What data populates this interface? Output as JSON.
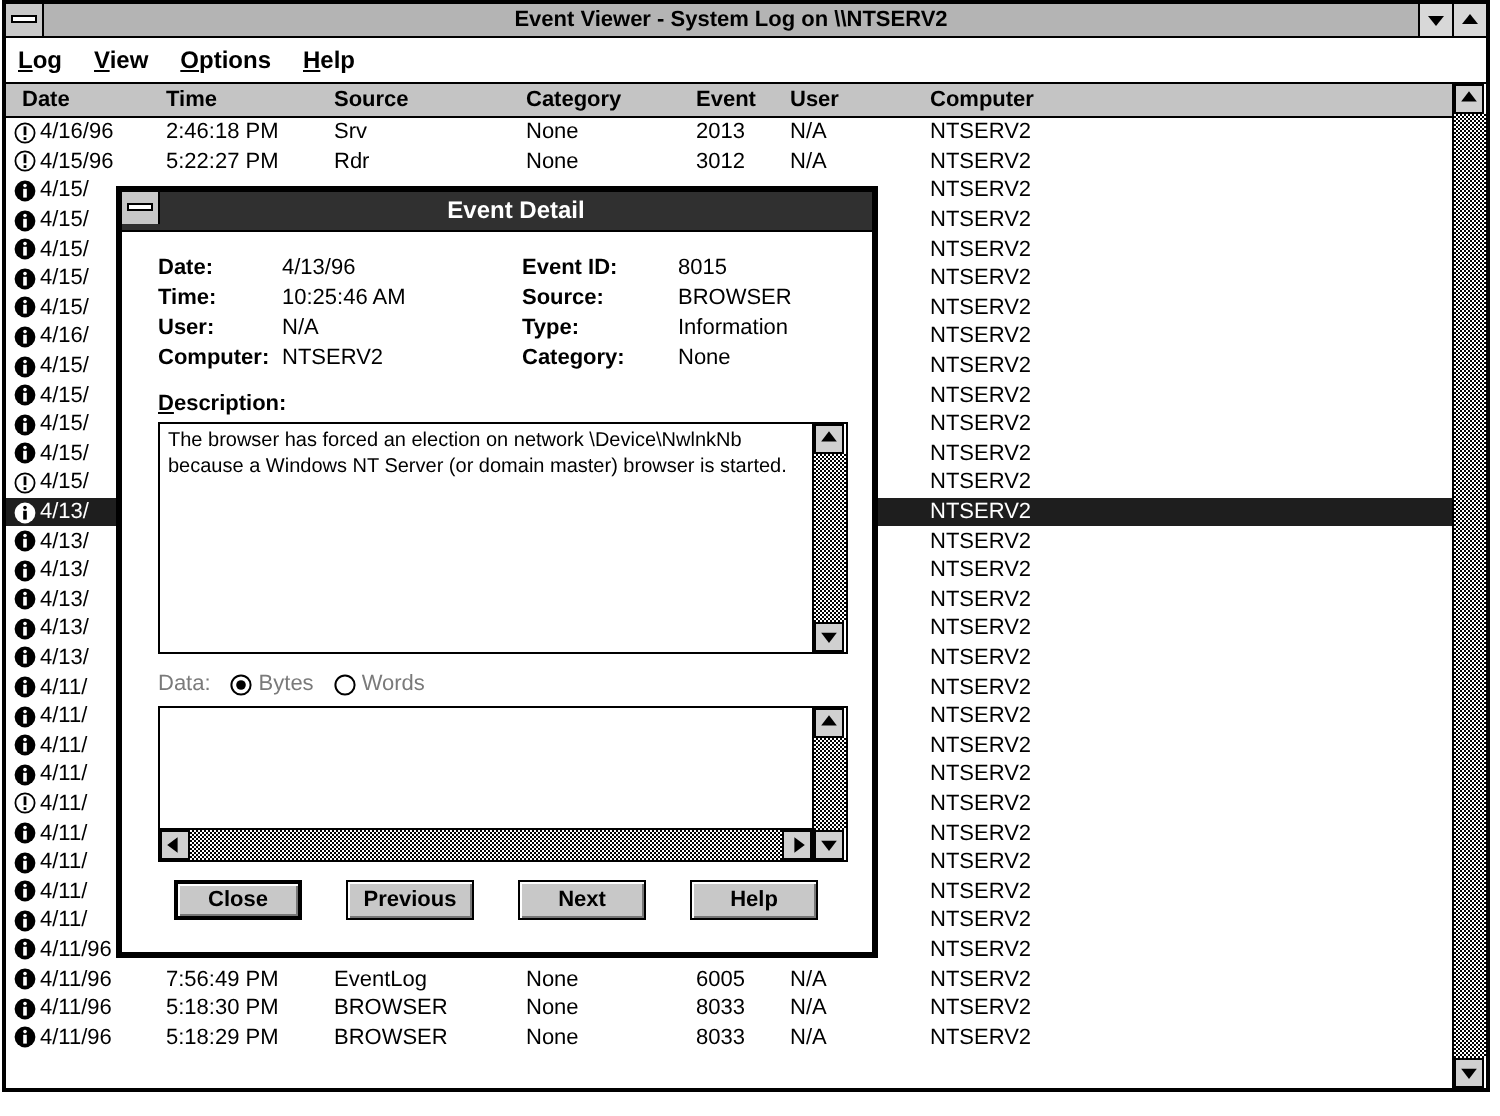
{
  "window": {
    "title": "Event Viewer - System Log on \\\\NTSERV2"
  },
  "menu": [
    {
      "label": "Log"
    },
    {
      "label": "View"
    },
    {
      "label": "Options"
    },
    {
      "label": "Help"
    }
  ],
  "columns": [
    "Date",
    "Time",
    "Source",
    "Category",
    "Event",
    "User",
    "Computer"
  ],
  "rows": [
    {
      "kind": "warning",
      "selected": false,
      "date": "4/16/96",
      "time": "2:46:18 PM",
      "source": "Srv",
      "category": "None",
      "event": "2013",
      "user": "N/A",
      "computer": "NTSERV2"
    },
    {
      "kind": "warning",
      "selected": false,
      "date": "4/15/96",
      "time": "5:22:27 PM",
      "source": "Rdr",
      "category": "None",
      "event": "3012",
      "user": "N/A",
      "computer": "NTSERV2"
    },
    {
      "kind": "info",
      "selected": false,
      "date": "4/15/",
      "computer": "NTSERV2"
    },
    {
      "kind": "info",
      "selected": false,
      "date": "4/15/",
      "computer": "NTSERV2"
    },
    {
      "kind": "info",
      "selected": false,
      "date": "4/15/",
      "computer": "NTSERV2"
    },
    {
      "kind": "info",
      "selected": false,
      "date": "4/15/",
      "computer": "NTSERV2"
    },
    {
      "kind": "info",
      "selected": false,
      "date": "4/15/",
      "computer": "NTSERV2"
    },
    {
      "kind": "info",
      "selected": false,
      "date": "4/16/",
      "computer": "NTSERV2"
    },
    {
      "kind": "info",
      "selected": false,
      "date": "4/15/",
      "computer": "NTSERV2"
    },
    {
      "kind": "info",
      "selected": false,
      "date": "4/15/",
      "computer": "NTSERV2"
    },
    {
      "kind": "info",
      "selected": false,
      "date": "4/15/",
      "computer": "NTSERV2"
    },
    {
      "kind": "info",
      "selected": false,
      "date": "4/15/",
      "computer": "NTSERV2"
    },
    {
      "kind": "warning",
      "selected": false,
      "date": "4/15/",
      "computer": "NTSERV2"
    },
    {
      "kind": "info",
      "selected": true,
      "date": "4/13/",
      "computer": "NTSERV2"
    },
    {
      "kind": "info",
      "selected": false,
      "date": "4/13/",
      "computer": "NTSERV2"
    },
    {
      "kind": "info",
      "selected": false,
      "date": "4/13/",
      "computer": "NTSERV2"
    },
    {
      "kind": "info",
      "selected": false,
      "date": "4/13/",
      "computer": "NTSERV2"
    },
    {
      "kind": "info",
      "selected": false,
      "date": "4/13/",
      "computer": "NTSERV2"
    },
    {
      "kind": "info",
      "selected": false,
      "date": "4/13/",
      "computer": "NTSERV2"
    },
    {
      "kind": "info",
      "selected": false,
      "date": "4/11/",
      "computer": "NTSERV2"
    },
    {
      "kind": "info",
      "selected": false,
      "date": "4/11/",
      "computer": "NTSERV2"
    },
    {
      "kind": "info",
      "selected": false,
      "date": "4/11/",
      "computer": "NTSERV2"
    },
    {
      "kind": "info",
      "selected": false,
      "date": "4/11/",
      "computer": "NTSERV2"
    },
    {
      "kind": "warning",
      "selected": false,
      "date": "4/11/",
      "computer": "NTSERV2"
    },
    {
      "kind": "info",
      "selected": false,
      "date": "4/11/",
      "computer": "NTSERV2"
    },
    {
      "kind": "info",
      "selected": false,
      "date": "4/11/",
      "computer": "NTSERV2"
    },
    {
      "kind": "info",
      "selected": false,
      "date": "4/11/",
      "computer": "NTSERV2"
    },
    {
      "kind": "info",
      "selected": false,
      "date": "4/11/",
      "computer": "NTSERV2"
    },
    {
      "kind": "info",
      "selected": false,
      "date": "4/11/96",
      "computer": "NTSERV2"
    },
    {
      "kind": "info",
      "selected": false,
      "date": "4/11/96",
      "time": "7:56:49 PM",
      "source": "EventLog",
      "category": "None",
      "event": "6005",
      "user": "N/A",
      "computer": "NTSERV2"
    },
    {
      "kind": "info",
      "selected": false,
      "date": "4/11/96",
      "time": "5:18:30 PM",
      "source": "BROWSER",
      "category": "None",
      "event": "8033",
      "user": "N/A",
      "computer": "NTSERV2"
    },
    {
      "kind": "info",
      "selected": false,
      "date": "4/11/96",
      "time": "5:18:29 PM",
      "source": "BROWSER",
      "category": "None",
      "event": "8033",
      "user": "N/A",
      "computer": "NTSERV2"
    }
  ],
  "dialog": {
    "title": "Event Detail",
    "left_fields": [
      {
        "label": "Date:",
        "value": "4/13/96"
      },
      {
        "label": "Time:",
        "value": "10:25:46 AM"
      },
      {
        "label": "User:",
        "value": "N/A"
      },
      {
        "label": "Computer:",
        "value": "NTSERV2"
      }
    ],
    "right_fields": [
      {
        "label": "Event ID:",
        "value": "8015"
      },
      {
        "label": "Source:",
        "value": "BROWSER"
      },
      {
        "label": "Type:",
        "value": "Information"
      },
      {
        "label": "Category:",
        "value": "None"
      }
    ],
    "description_label": "Description:",
    "description": "The browser has forced an election on network \\Device\\NwlnkNb because a Windows NT Server (or domain master) browser is started.",
    "data_label": "Data:",
    "data_options": [
      {
        "label": "Bytes",
        "selected": true
      },
      {
        "label": "Words",
        "selected": false
      }
    ],
    "buttons": [
      {
        "label": "Close",
        "default": true
      },
      {
        "label": "Previous",
        "default": false
      },
      {
        "label": "Next",
        "default": false
      },
      {
        "label": "Help",
        "default": false
      }
    ]
  }
}
